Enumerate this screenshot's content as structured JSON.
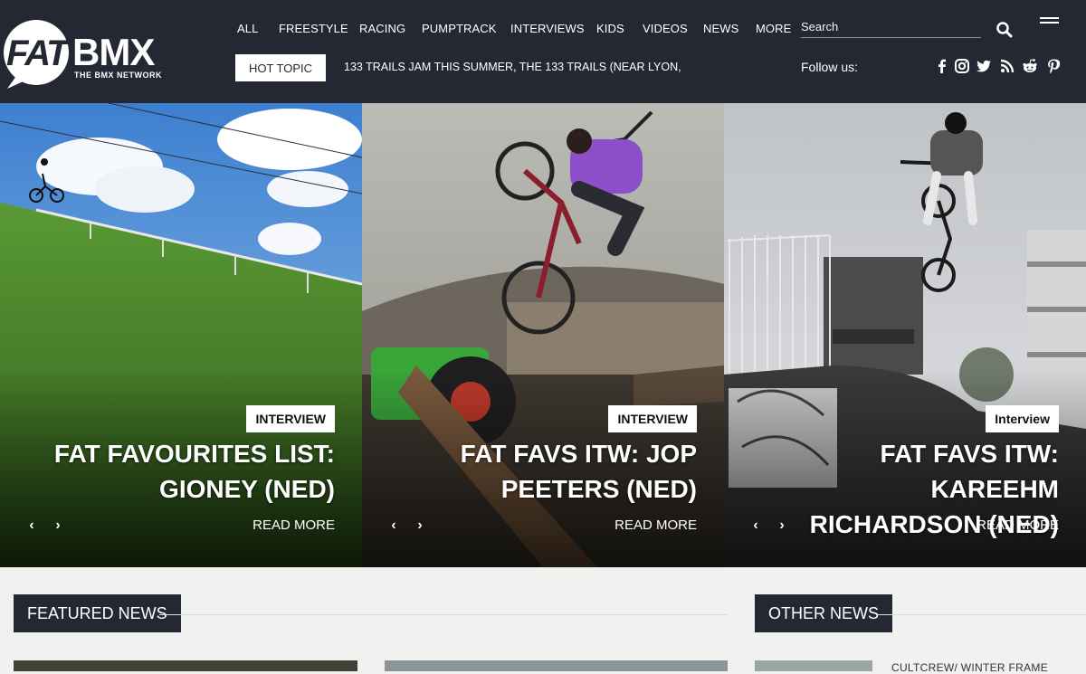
{
  "logo": {
    "top": "FATBMX",
    "tagline": "THE BMX NETWORK"
  },
  "nav": [
    "ALL",
    "FREESTYLE",
    "RACING",
    "PUMPTRACK",
    "INTERVIEWS",
    "KIDS",
    "VIDEOS",
    "NEWS",
    "MORE"
  ],
  "search": {
    "placeholder": "Search"
  },
  "hot_topic": {
    "label": "HOT TOPIC",
    "ticker": "133 TRAILS JAM THIS SUMMER, THE 133 TRAILS (NEAR LYON,"
  },
  "follow": {
    "label": "Follow us:",
    "icons": [
      "facebook-icon",
      "instagram-icon",
      "twitter-icon",
      "rss-icon",
      "reddit-icon",
      "pinterest-icon"
    ]
  },
  "slides": [
    {
      "category": "INTERVIEW",
      "title": "FAT FAVOURITES LIST: GIONEY (NED)",
      "read_more": "READ MORE",
      "prev": "‹",
      "next": "›"
    },
    {
      "category": "INTERVIEW",
      "title": "FAT FAVS ITW: JOP PEETERS (NED)",
      "read_more": "READ MORE",
      "prev": "‹",
      "next": "›"
    },
    {
      "category": "Interview",
      "title": "FAT FAVS ITW: KAREEHM RICHARDSON (NED)",
      "read_more": "READ MORE",
      "prev": "‹",
      "next": "›"
    }
  ],
  "sections": {
    "featured": "FEATURED NEWS",
    "other": "OTHER NEWS"
  },
  "other_news": {
    "first_title": "CULTCREW/ WINTER FRAME"
  },
  "colors": {
    "header_bg": "#232833",
    "page_bg": "#f1f1ef",
    "accent": "#ffffff"
  }
}
